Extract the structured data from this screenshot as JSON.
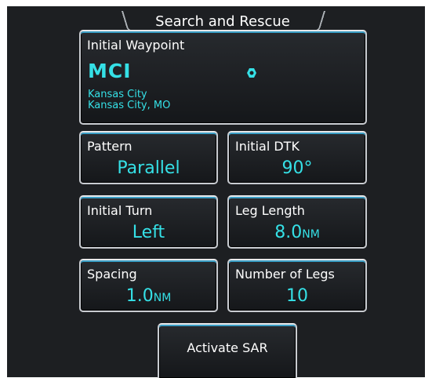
{
  "title": "Search and Rescue",
  "waypoint": {
    "label": "Initial Waypoint",
    "ident": "MCI",
    "line1": "Kansas City",
    "line2": "Kansas City, MO",
    "icon": "vor-icon"
  },
  "pattern": {
    "label": "Pattern",
    "value": "Parallel"
  },
  "initial_dtk": {
    "label": "Initial DTK",
    "value": "90°"
  },
  "initial_turn": {
    "label": "Initial Turn",
    "value": "Left"
  },
  "leg_length": {
    "label": "Leg Length",
    "value": "8.0",
    "unit": "NM"
  },
  "spacing": {
    "label": "Spacing",
    "value": "1.0",
    "unit": "NM"
  },
  "number_of_legs": {
    "label": "Number of Legs",
    "value": "10"
  },
  "activate": {
    "label": "Activate SAR"
  },
  "colors": {
    "accent": "#35e0e6",
    "background": "#1d1f22",
    "border": "#c9ccd1"
  }
}
